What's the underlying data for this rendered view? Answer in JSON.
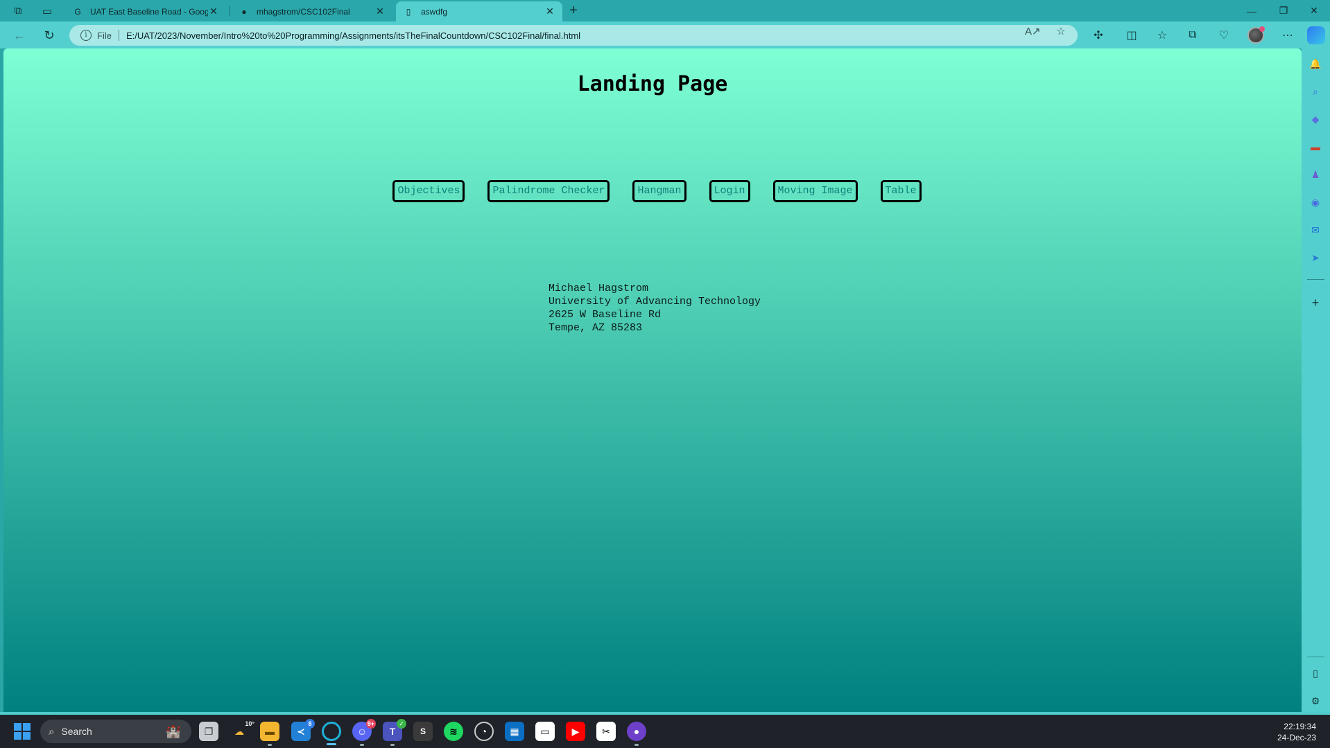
{
  "browser": {
    "tabs": [
      {
        "title": "UAT East Baseline Road - Google",
        "favicon": "google-icon",
        "active": false
      },
      {
        "title": "mhagstrom/CSC102Final",
        "favicon": "github-icon",
        "active": false
      },
      {
        "title": "aswdfg",
        "favicon": "file-icon",
        "active": true
      }
    ],
    "protocol_label": "File",
    "url": "E:/UAT/2023/November/Intro%20to%20Programming/Assignments/itsTheFinalCountdown/CSC102Final/final.html"
  },
  "page": {
    "title": "Landing Page",
    "nav_links": [
      "Objectives",
      "Palindrome Checker",
      "Hangman",
      "Login",
      "Moving Image",
      "Table"
    ],
    "address": {
      "name": "Michael Hagstrom",
      "org": "University of Advancing Technology",
      "street": "2625 W Baseline Rd",
      "city": "Tempe, AZ 85283"
    },
    "gradient": {
      "top": "#7fffd4",
      "bottom": "#008080"
    }
  },
  "taskbar": {
    "search_placeholder": "Search",
    "weather_temp": "10°",
    "badges": {
      "vscode": "8",
      "discord": "9+"
    },
    "time": "22:19:34",
    "date": "24-Dec-23"
  }
}
